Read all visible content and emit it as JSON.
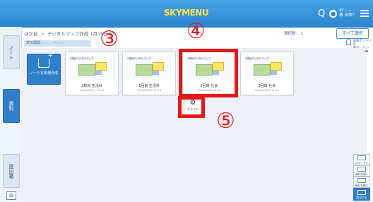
{
  "header": {
    "logo_text": "SKYMENU",
    "user_line1": "ID: ----",
    "user_line2": "教 天郎？",
    "search_icon": "search-icon",
    "user_icon": "user-icon",
    "menu_icon": "hamburger-menu-icon"
  },
  "sidebar": {
    "tab_note": "ノート",
    "tab_shiryo": "資料",
    "tab_history": "提出箱",
    "bottom_icon": "book-icon"
  },
  "breadcrumb": {
    "root": "ほか自",
    "current": "デジタルマップ作成 1月19日 (0)"
  },
  "toolbar": {
    "selected_count_label": "選択数： 1",
    "select_all_label": "すべて選択",
    "period_label": "表示期間：- - - - ～ - - - -",
    "hide_label_line1": "非表示ノートを",
    "hide_label_line2": "表示しない"
  },
  "new_note": {
    "label": "ノートを新規作成"
  },
  "cards": [
    {
      "thumb_title": "2週目デジタルマップ",
      "title": "2枚目 生活科",
      "date": "2020/06/03 11:24"
    },
    {
      "thumb_title": "2週目デジタルマップ",
      "title": "1回目 生活科",
      "date": "2020/06/03 11:24"
    },
    {
      "thumb_title": "2週目デジタルマップ",
      "title": "2回目 社会",
      "date": "2020/06/03 11:24"
    },
    {
      "thumb_title": "2週目デジタルマップ",
      "title": "3回目 社会",
      "date": "2020/06/03 11:24"
    }
  ],
  "popup": {
    "label": "スライド",
    "icon": "gear-icon"
  },
  "annotations": {
    "n3": "③",
    "n4": "④",
    "n5": "⑤",
    "color": "#e01a1a"
  },
  "right_tools": {
    "slide": "スライドショー",
    "item2": "資料を開く",
    "item3": "資料を閉じる",
    "item4": "提出する"
  }
}
